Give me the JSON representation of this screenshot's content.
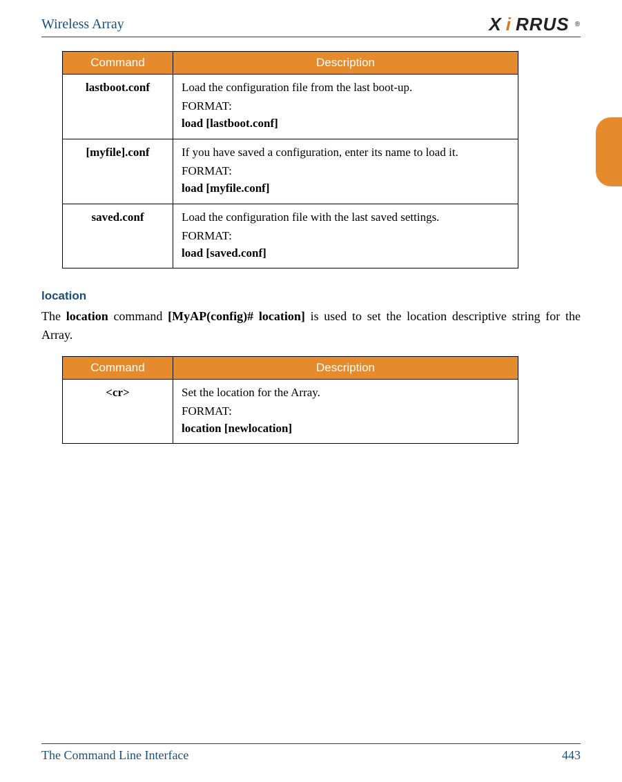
{
  "header": {
    "title": "Wireless Array",
    "brand_prefix": "X",
    "brand_mark": "i",
    "brand_suffix": "RRUS",
    "reg": "®"
  },
  "table1": {
    "headers": {
      "col1": "Command",
      "col2": "Description"
    },
    "rows": [
      {
        "command": "lastboot.conf",
        "desc": "Load the configuration file from the last boot-up.",
        "format_label": "FORMAT:",
        "format_bold": "load [lastboot.conf]"
      },
      {
        "command": "[myfile].conf",
        "desc": "If you have saved a configuration, enter its name to load it.",
        "format_label": "FORMAT:",
        "format_bold": "load [myfile.conf]"
      },
      {
        "command": "saved.conf",
        "desc": "Load the configuration file with the last saved settings.",
        "format_label": "FORMAT:",
        "format_bold": "load [saved.conf]"
      }
    ]
  },
  "section": {
    "heading": "location",
    "text_parts": {
      "p1": "The ",
      "b1": "location",
      "p2": " command ",
      "b2": "[MyAP(config)# location]",
      "p3": " is used to set the location descriptive string for the Array."
    }
  },
  "table2": {
    "headers": {
      "col1": "Command",
      "col2": "Description"
    },
    "row": {
      "command": "<cr>",
      "desc": "Set the location for the Array.",
      "format_label": "FORMAT:",
      "format_bold": "location [newlocation]"
    }
  },
  "footer": {
    "left": "The Command Line Interface",
    "right": "443"
  }
}
